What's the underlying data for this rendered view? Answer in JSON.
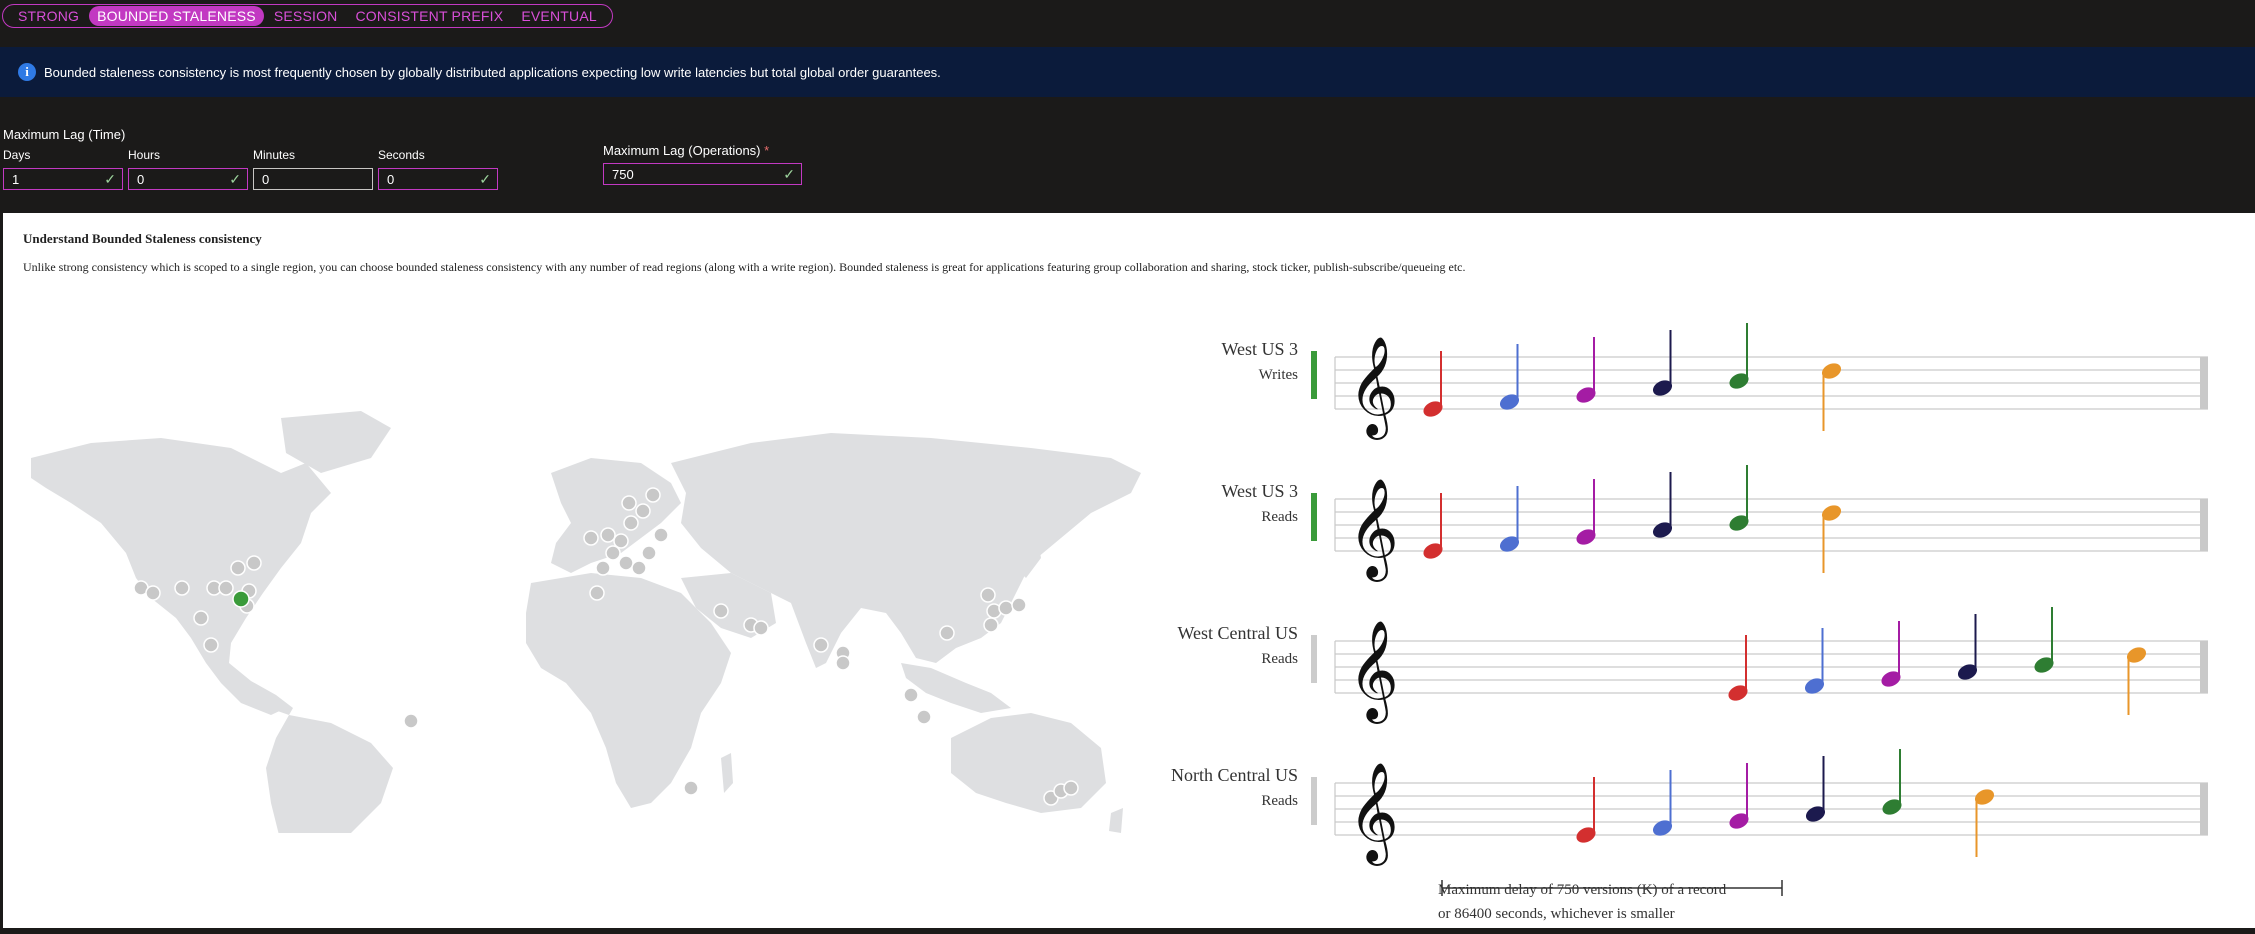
{
  "tabs": [
    {
      "label": "STRONG",
      "active": false
    },
    {
      "label": "BOUNDED STALENESS",
      "active": true
    },
    {
      "label": "SESSION",
      "active": false
    },
    {
      "label": "CONSISTENT PREFIX",
      "active": false
    },
    {
      "label": "EVENTUAL",
      "active": false
    }
  ],
  "info": {
    "text": "Bounded staleness consistency is most frequently chosen by globally distributed applications expecting low write latencies but total global order guarantees."
  },
  "lag_time": {
    "title": "Maximum Lag (Time)",
    "days": {
      "label": "Days",
      "value": "1"
    },
    "hours": {
      "label": "Hours",
      "value": "0"
    },
    "minutes": {
      "label": "Minutes",
      "value": "0"
    },
    "seconds": {
      "label": "Seconds",
      "value": "0"
    }
  },
  "lag_ops": {
    "label": "Maximum Lag (Operations)",
    "required_mark": "*",
    "value": "750"
  },
  "explain": {
    "title": "Understand Bounded Staleness consistency",
    "description": "Unlike strong consistency which is scoped to a single region, you can choose bounded staleness consistency with any number of read regions (along with a write region). Bounded staleness is great for applications featuring group collaboration and sharing, stock ticker, publish-subscribe/queueing etc."
  },
  "staves": [
    {
      "region": "West US 3",
      "role": "Writes",
      "marker": "green"
    },
    {
      "region": "West US 3",
      "role": "Reads",
      "marker": "green"
    },
    {
      "region": "West Central US",
      "role": "Reads",
      "marker": "grey"
    },
    {
      "region": "North Central US",
      "role": "Reads",
      "marker": "grey"
    }
  ],
  "note_colors": [
    "#d32f2f",
    "#4e6fd1",
    "#a41ca4",
    "#1c1a4e",
    "#2e7d32",
    "#e8962a"
  ],
  "lag_caption": {
    "line1": "Maximum delay of 750 versions (K) of a record",
    "line2": "or 86400 seconds, whichever is smaller"
  },
  "icons": {
    "info": "info-icon",
    "check": "check-icon",
    "clef": "treble-clef-icon"
  },
  "colors": {
    "accent": "#c239c2",
    "info_bg": "#0b1b3b",
    "write_region": "#3a9b3a",
    "region_dot": "#c8c8c8"
  }
}
